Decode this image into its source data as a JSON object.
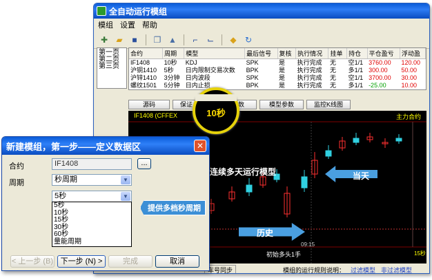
{
  "main_window": {
    "title": "全自动运行模组",
    "menu": [
      "模组",
      "设置",
      "帮助"
    ],
    "sidebar_items": [
      "第一页",
      "第二页",
      "第三页"
    ],
    "table": {
      "headers": [
        "合约",
        "周期",
        "模型",
        "最后信号",
        "复核",
        "执行情况",
        "挂单",
        "持仓",
        "平仓盈亏",
        "浮动盈"
      ],
      "rows": [
        [
          "IF1408",
          "10秒",
          "KDJ",
          "SPK",
          "是",
          "执行完成",
          "无",
          "空1/1",
          "3760.00",
          "120.00"
        ],
        [
          "沪铜1410",
          "5秒",
          "日内限制交易次数",
          "BPK",
          "是",
          "执行完成",
          "无",
          "多1/1",
          "300.00",
          "50.00"
        ],
        [
          "沪锌1410",
          "3分钟",
          "日内波段",
          "SPK",
          "是",
          "执行完成",
          "无",
          "空1/1",
          "3700.00",
          "30.00"
        ],
        [
          "螺纹1501",
          "5分钟",
          "日内止损",
          "BPK",
          "是",
          "执行完成",
          "无",
          "多1/1",
          "-25.00",
          "10.00"
        ]
      ]
    },
    "tabs": [
      "源码",
      "保证",
      "数",
      "参数",
      "模型参数",
      "监控K线图"
    ],
    "chart_header": "IF1408 (CFFEX",
    "chart_header_right": "主力合约",
    "annotation_multi_day": "连续多天运行模型",
    "annotation_today": "当天",
    "annotation_history": "历史",
    "annotation_start": "初始多头1手",
    "time_label": "09:15",
    "period_tag": "15秒",
    "status_sync": "车号同步",
    "status_label": "模组的运行规则说明：",
    "status_link1": "过滤模型",
    "status_link2": "非过滤模型"
  },
  "zoom_circle": {
    "label": "10秒"
  },
  "dialog": {
    "title": "新建模组，第一步——定义数据区",
    "contract_label": "合约",
    "contract_value": "IF1408",
    "browse": "...",
    "period_label": "周期",
    "period_value": "秒周期",
    "sub_period_value": "5秒",
    "options": [
      "5秒",
      "10秒",
      "15秒",
      "30秒",
      "60秒",
      "量能周期"
    ],
    "callout": "提供多档秒周期",
    "btn_prev": "< 上一步 (B)",
    "btn_next": "下一步 (N) >",
    "btn_finish": "完成",
    "btn_cancel": "取消"
  }
}
